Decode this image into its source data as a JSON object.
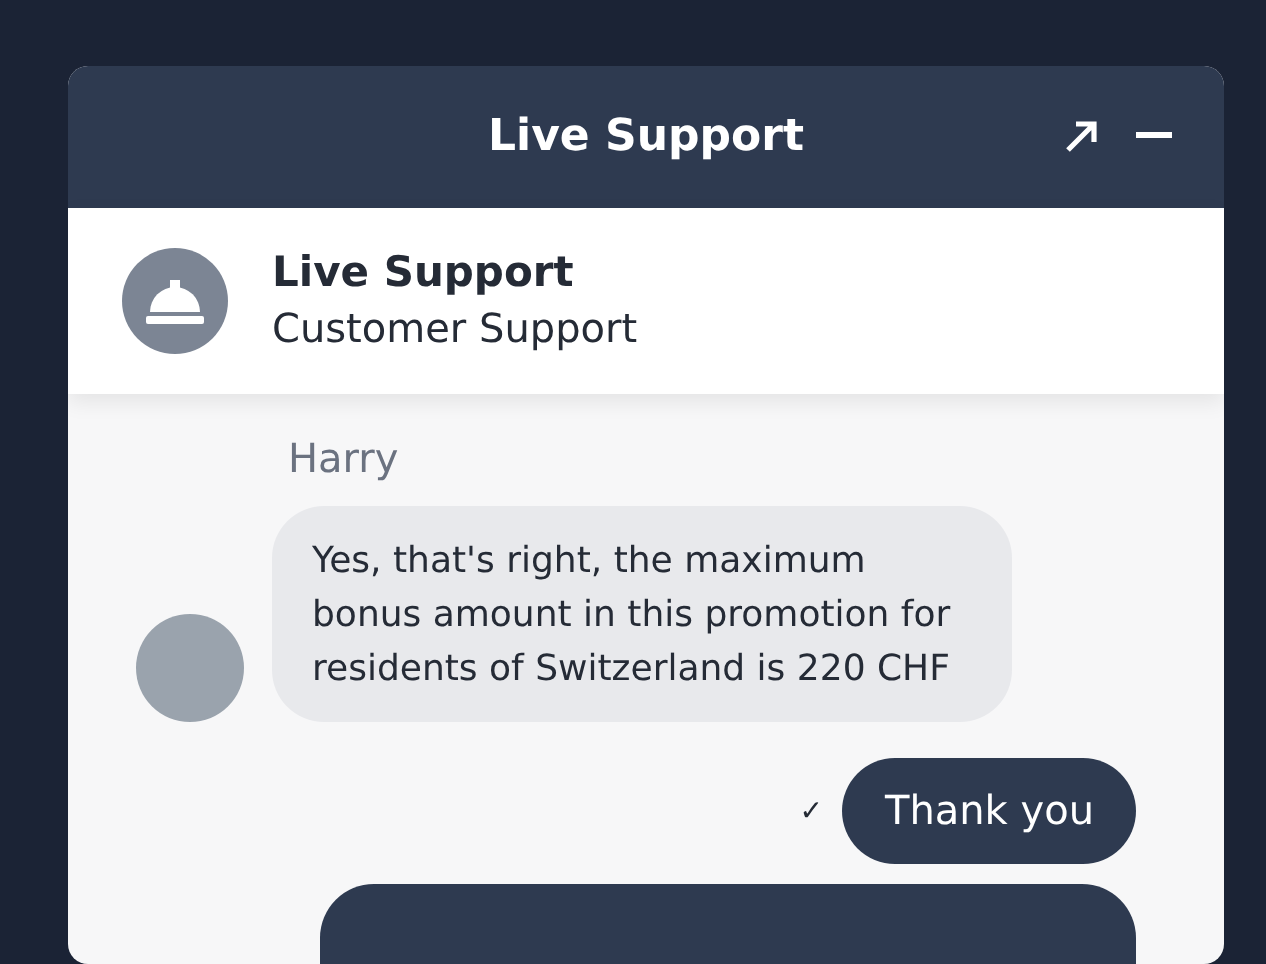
{
  "window": {
    "title": "Live Support"
  },
  "agent": {
    "name": "Live Support",
    "role": "Customer Support"
  },
  "messages": [
    {
      "kind": "incoming",
      "sender": "Harry",
      "text": "Yes, that's right, the maximum bonus amount in this promotion for residents of Switzerland is 220 CHF"
    },
    {
      "kind": "outgoing",
      "status": "✓",
      "text": "Thank you"
    },
    {
      "kind": "partial"
    }
  ]
}
